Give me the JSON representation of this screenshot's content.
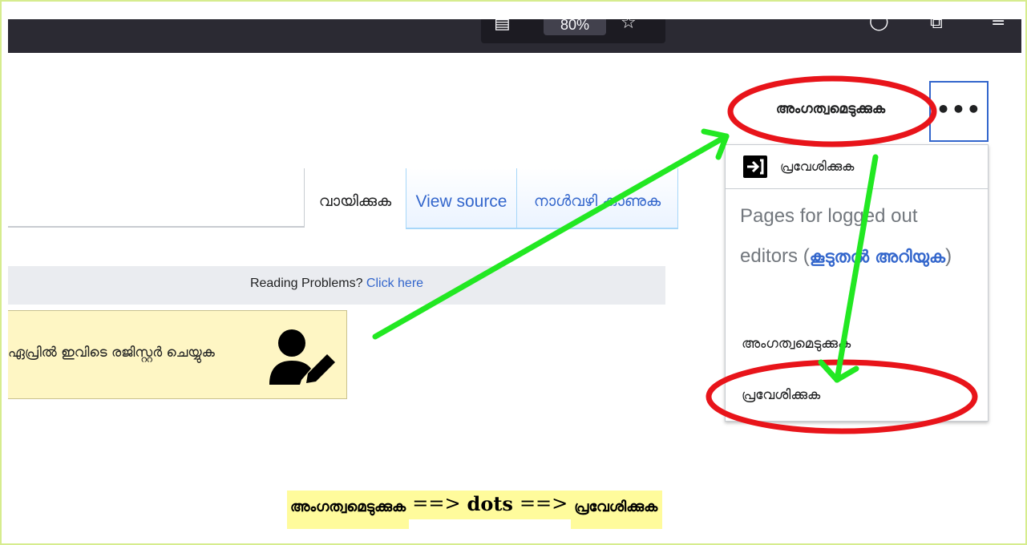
{
  "browser": {
    "zoom": "80%"
  },
  "tabs": {
    "read": "വായിക്കുക",
    "view_source": "View source",
    "history": "നാൾവഴി കാണുക"
  },
  "reading_bar": {
    "text": "Reading Problems?",
    "link": "Click here"
  },
  "register_banner": {
    "text": "ഏപ്രിൽ ഇവിടെ രജിസ്റ്റർ ചെയ്യുക"
  },
  "header": {
    "create_account": "അംഗത്വമെടുക്കുക",
    "more_label": "•••"
  },
  "dropdown": {
    "login": "പ്രവേശിക്കുക",
    "pages_heading": "Pages for logged out editors (",
    "learn_more": "കൂടുതൽ അറിയുക",
    "pages_heading_close": ")",
    "create_account": "അംഗത്വമെടുക്കുക",
    "login2": "പ്രവേശിക്കുക"
  },
  "caption": {
    "part1": "അംഗത്വമെടുക്കുക",
    "arrow1": "==>",
    "dots": "dots",
    "arrow2": "==>",
    "part2": "പ്രവേശിക്കുക"
  },
  "colors": {
    "highlight": "#fffb9c",
    "circle": "#e8141a",
    "arrow": "#22e822",
    "link": "#3366cc"
  }
}
